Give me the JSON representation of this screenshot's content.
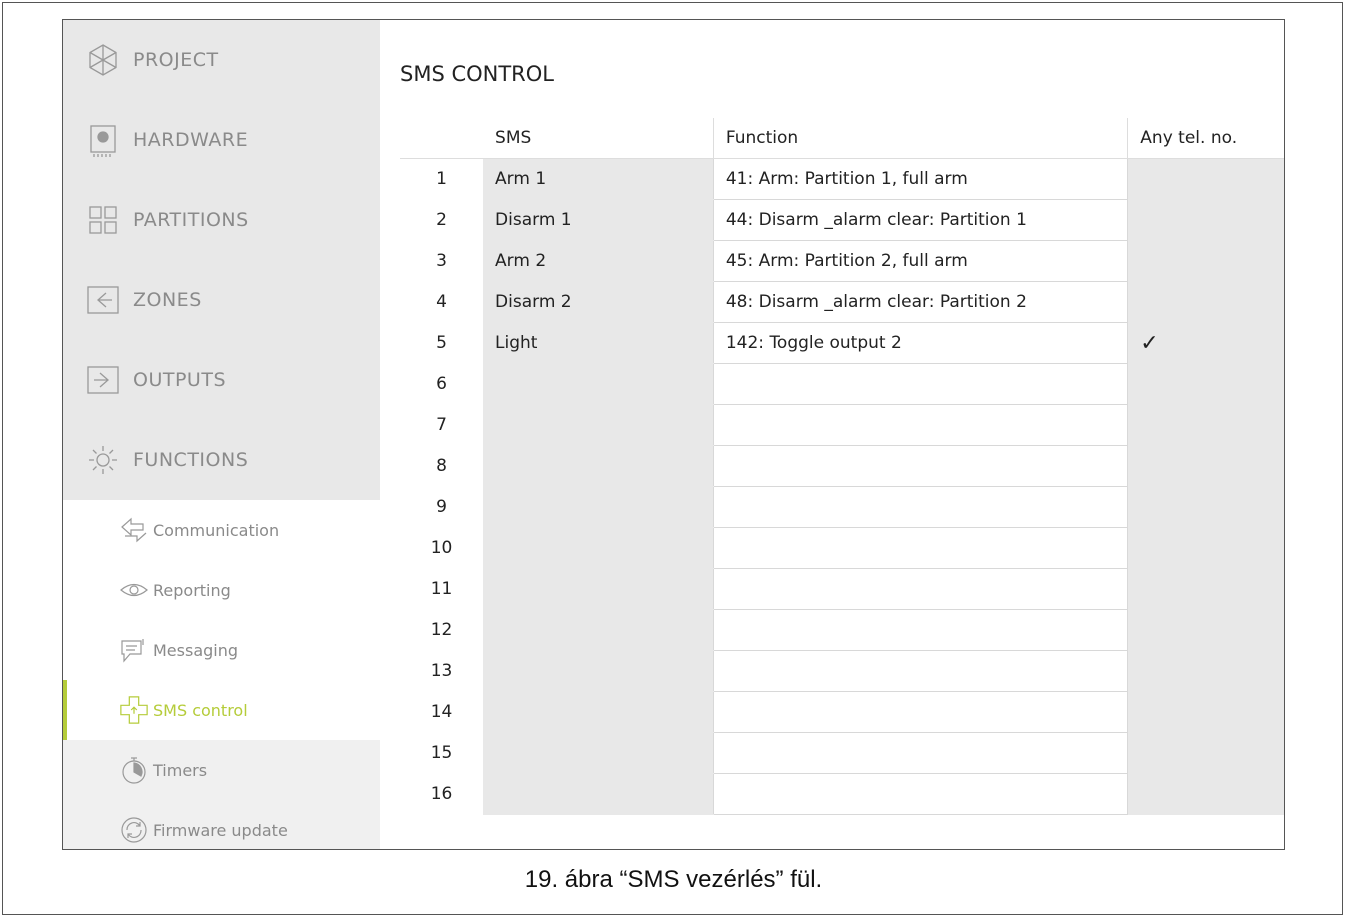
{
  "nav": {
    "items": [
      {
        "label": "PROJECT",
        "icon": "project-icon"
      },
      {
        "label": "HARDWARE",
        "icon": "hardware-icon"
      },
      {
        "label": "PARTITIONS",
        "icon": "partitions-icon"
      },
      {
        "label": "ZONES",
        "icon": "zones-icon"
      },
      {
        "label": "OUTPUTS",
        "icon": "outputs-icon"
      },
      {
        "label": "FUNCTIONS",
        "icon": "functions-icon"
      }
    ],
    "sub_items": [
      {
        "label": "Communication",
        "icon": "communication-icon"
      },
      {
        "label": "Reporting",
        "icon": "reporting-icon"
      },
      {
        "label": "Messaging",
        "icon": "messaging-icon"
      },
      {
        "label": "SMS control",
        "icon": "sms-control-icon"
      },
      {
        "label": "Timers",
        "icon": "timer-icon"
      },
      {
        "label": "Firmware update",
        "icon": "firmware-update-icon"
      }
    ],
    "active_sub": "SMS control",
    "accent": "#b5cc3a"
  },
  "page": {
    "title": "SMS CONTROL"
  },
  "table": {
    "headers": {
      "sms": "SMS",
      "function": "Function",
      "any": "Any tel. no."
    },
    "rows": [
      {
        "n": "1",
        "sms": "Arm 1",
        "function": "41: Arm: Partition   1, full arm",
        "any": ""
      },
      {
        "n": "2",
        "sms": "Disarm 1",
        "function": "44: Disarm _alarm clear: Partition   1",
        "any": ""
      },
      {
        "n": "3",
        "sms": "Arm 2",
        "function": "45: Arm: Partition   2, full arm",
        "any": ""
      },
      {
        "n": "4",
        "sms": "Disarm 2",
        "function": "48: Disarm _alarm clear: Partition   2",
        "any": ""
      },
      {
        "n": "5",
        "sms": "Light",
        "function": "142: Toggle output 2",
        "any": "✓"
      },
      {
        "n": "6",
        "sms": "",
        "function": "",
        "any": ""
      },
      {
        "n": "7",
        "sms": "",
        "function": "",
        "any": ""
      },
      {
        "n": "8",
        "sms": "",
        "function": "",
        "any": ""
      },
      {
        "n": "9",
        "sms": "",
        "function": "",
        "any": ""
      },
      {
        "n": "10",
        "sms": "",
        "function": "",
        "any": ""
      },
      {
        "n": "11",
        "sms": "",
        "function": "",
        "any": ""
      },
      {
        "n": "12",
        "sms": "",
        "function": "",
        "any": ""
      },
      {
        "n": "13",
        "sms": "",
        "function": "",
        "any": ""
      },
      {
        "n": "14",
        "sms": "",
        "function": "",
        "any": ""
      },
      {
        "n": "15",
        "sms": "",
        "function": "",
        "any": ""
      },
      {
        "n": "16",
        "sms": "",
        "function": "",
        "any": ""
      }
    ]
  },
  "caption": "19. ábra “SMS vezérlés” fül."
}
